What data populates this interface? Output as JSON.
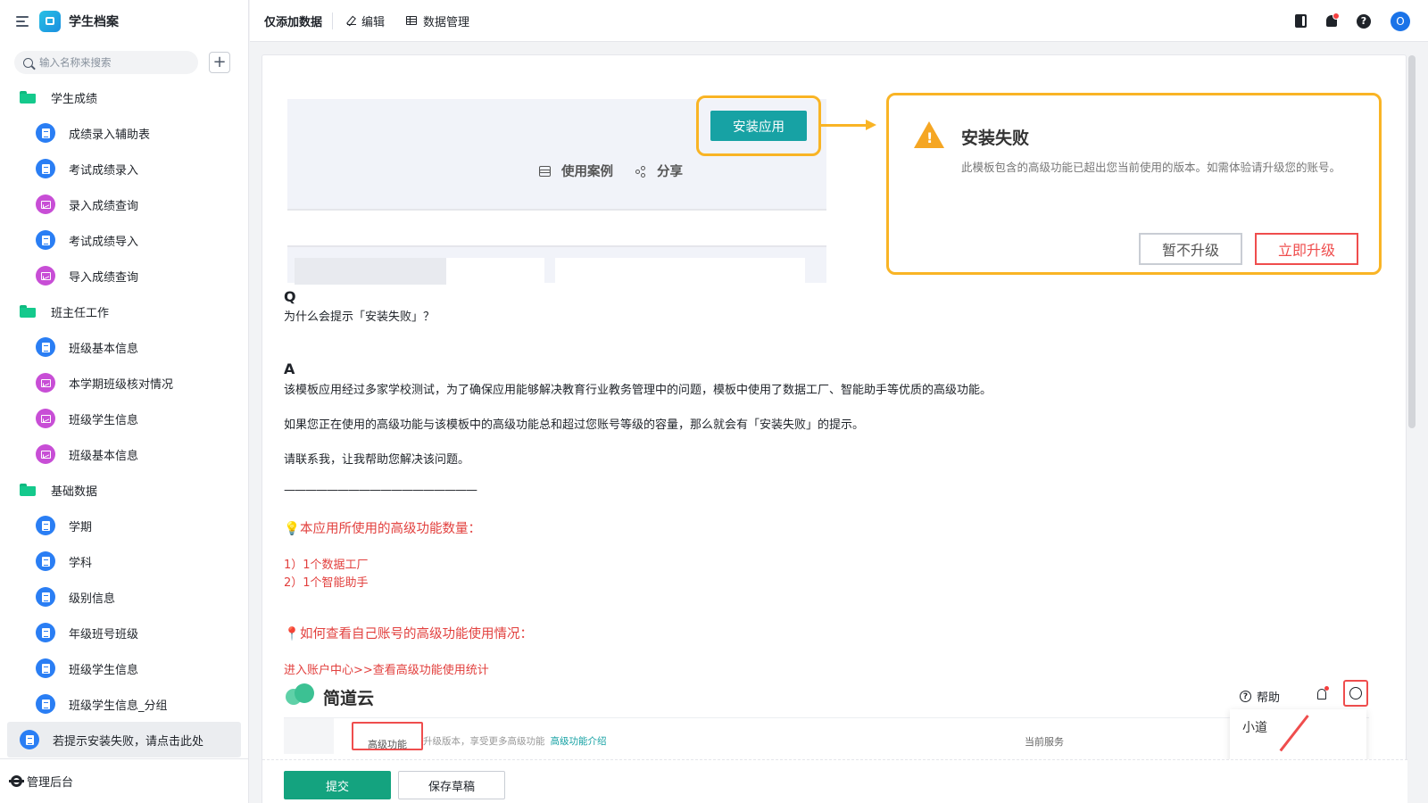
{
  "app": {
    "title": "学生档案"
  },
  "search": {
    "placeholder": "输入名称来搜索"
  },
  "sidebar": {
    "items": [
      {
        "label": "学生成绩",
        "type": "folder"
      },
      {
        "label": "成绩录入辅助表",
        "type": "form"
      },
      {
        "label": "考试成绩录入",
        "type": "form"
      },
      {
        "label": "录入成绩查询",
        "type": "report"
      },
      {
        "label": "考试成绩导入",
        "type": "form"
      },
      {
        "label": "导入成绩查询",
        "type": "report"
      },
      {
        "label": "班主任工作",
        "type": "folder"
      },
      {
        "label": "班级基本信息",
        "type": "form"
      },
      {
        "label": "本学期班级核对情况",
        "type": "report"
      },
      {
        "label": "班级学生信息",
        "type": "report"
      },
      {
        "label": "班级基本信息",
        "type": "report"
      },
      {
        "label": "基础数据",
        "type": "folder"
      },
      {
        "label": "学期",
        "type": "form"
      },
      {
        "label": "学科",
        "type": "form"
      },
      {
        "label": "级别信息",
        "type": "form"
      },
      {
        "label": "年级班号班级",
        "type": "form"
      },
      {
        "label": "班级学生信息",
        "type": "form"
      },
      {
        "label": "班级学生信息_分组",
        "type": "form"
      },
      {
        "label": "若提示安装失败，请点击此处",
        "type": "form",
        "active": true
      }
    ],
    "footer_label": "管理后台"
  },
  "topbar": {
    "title": "仅添加数据",
    "edit_label": "编辑",
    "data_manage_label": "数据管理",
    "avatar_letter": "O"
  },
  "illustration": {
    "use_cases": "使用案例",
    "share": "分享",
    "install": "安装应用",
    "dialog_title": "安装失败",
    "dialog_message": "此模板包含的高级功能已超出您当前使用的版本。如需体验请升级您的账号。",
    "btn_later": "暂不升级",
    "btn_upgrade": "立即升级"
  },
  "content": {
    "q_letter": "Q",
    "question": "为什么会提示「安装失败」？",
    "a_letter": "A",
    "answer1": "该模板应用经过多家学校测试，为了确保应用能够解决教育行业教务管理中的问题，模板中使用了数据工厂、智能助手等优质的高级功能。",
    "answer2": "如果您正在使用的高级功能与该模板中的高级功能总和超过您账号等级的容量，那么就会有「安装失败」的提示。",
    "answer3": "请联系我，让我帮助您解决该问题。",
    "divider": "——————————————————",
    "features_heading": "💡本应用所使用的高级功能数量：",
    "feature1": "1）1个数据工厂",
    "feature2": "2）1个智能助手",
    "howto_heading": "📍如何查看自己账号的高级功能使用情况：",
    "howto_path": "进入账户中心>>查看高级功能使用统计"
  },
  "bottom_shot": {
    "brand": "简道云",
    "help": "帮助",
    "feature_tab": "高级功能",
    "feature_desc": "升级版本，享受更多高级功能",
    "feature_link": "高级功能介绍",
    "current_service": "当前服务",
    "user_name": "小道"
  },
  "footer": {
    "submit": "提交",
    "draft": "保存草稿"
  },
  "colors": {
    "accent": "#14a37f",
    "highlight": "#f9b425",
    "warning_red": "#e2403e",
    "install_teal": "#17a2a4"
  }
}
